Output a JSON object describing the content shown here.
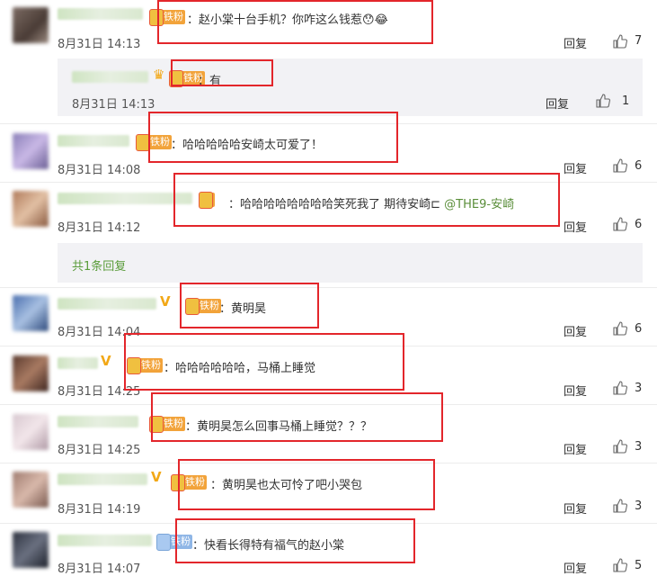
{
  "comments": [
    {
      "text": "：赵小棠十台手机？你咋这么钱惹",
      "date": "8月31日 14:13",
      "reply": "回复",
      "likes": "7",
      "badge": "铁粉"
    },
    {
      "text": "：有",
      "date": "8月31日 14:13",
      "reply": "回复",
      "likes": "1",
      "badge": "铁粉"
    },
    {
      "text": "：哈哈哈哈哈安崎太可爱了！",
      "date": "8月31日 14:08",
      "reply": "回复",
      "likes": "6",
      "badge": "铁粉"
    },
    {
      "text": "：哈哈哈哈哈哈哈哈笑死我了 期待安崎",
      "mention": "@THE9-安崎",
      "date": "8月31日 14:12",
      "reply": "回复",
      "likes": "6"
    },
    {
      "text": "：黄明昊",
      "date": "8月31日 14:04",
      "reply": "回复",
      "likes": "6",
      "badge": "铁粉"
    },
    {
      "text": "：哈哈哈哈哈哈，马桶上睡觉",
      "date": "8月31日 14:25",
      "reply": "回复",
      "likes": "3",
      "badge": "铁粉"
    },
    {
      "text": "：黄明昊怎么回事马桶上睡觉？？？",
      "date": "8月31日 14:25",
      "reply": "回复",
      "likes": "3",
      "badge": "铁粉"
    },
    {
      "text": "：黄明昊也太可怜了吧小哭包",
      "date": "8月31日 14:19",
      "reply": "回复",
      "likes": "3",
      "badge": "铁粉"
    },
    {
      "text": "：快看长得特有福气的赵小棠",
      "date": "8月31日 14:07",
      "reply": "回复",
      "likes": "5",
      "badge": "铁粉"
    }
  ],
  "more_replies": "共1条回复",
  "icons": {
    "like": "thumbs-up-icon",
    "verified": "v-badge-icon",
    "fan": "fan-badge-icon",
    "emoji": "emoji-icon"
  },
  "colors": {
    "highlight": "#e3262b",
    "link": "#5a9c3a",
    "badge": "#f2a33a"
  }
}
